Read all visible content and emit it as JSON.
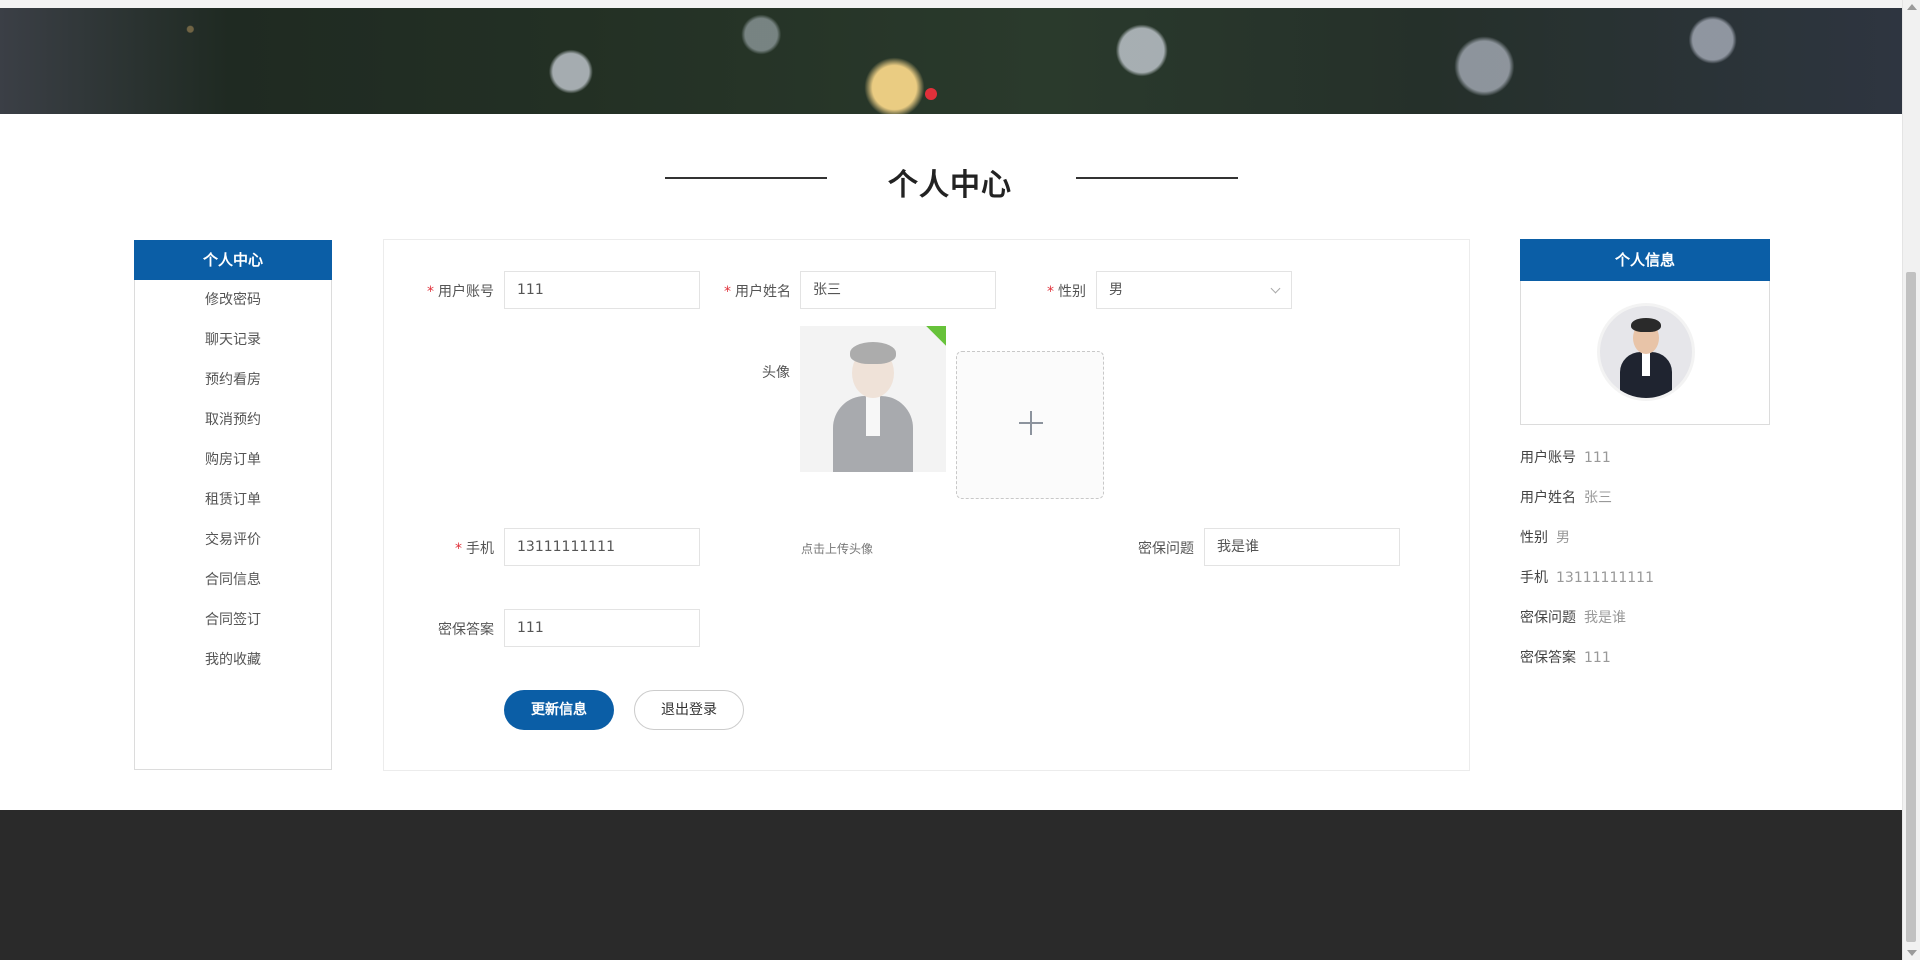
{
  "page": {
    "title": "个人中心"
  },
  "sidebar": {
    "header": "个人中心",
    "items": [
      {
        "label": "修改密码"
      },
      {
        "label": "聊天记录"
      },
      {
        "label": "预约看房"
      },
      {
        "label": "取消预约"
      },
      {
        "label": "购房订单"
      },
      {
        "label": "租赁订单"
      },
      {
        "label": "交易评价"
      },
      {
        "label": "合同信息"
      },
      {
        "label": "合同签订"
      },
      {
        "label": "我的收藏"
      }
    ]
  },
  "form": {
    "account": {
      "label": "用户账号",
      "value": "111",
      "required": "*"
    },
    "name": {
      "label": "用户姓名",
      "value": "张三",
      "required": "*"
    },
    "gender": {
      "label": "性别",
      "value": "男",
      "required": "*"
    },
    "avatar": {
      "label": "头像",
      "hint": "点击上传头像"
    },
    "phone": {
      "label": "手机",
      "value": "13111111111",
      "required": "*"
    },
    "question": {
      "label": "密保问题",
      "value": "我是谁"
    },
    "answer": {
      "label": "密保答案",
      "value": "111"
    },
    "update_button": "更新信息",
    "logout_button": "退出登录"
  },
  "info": {
    "header": "个人信息",
    "rows": [
      {
        "label": "用户账号",
        "value": "111"
      },
      {
        "label": "用户姓名",
        "value": "张三"
      },
      {
        "label": "性别",
        "value": "男"
      },
      {
        "label": "手机",
        "value": "13111111111"
      },
      {
        "label": "密保问题",
        "value": "我是谁"
      },
      {
        "label": "密保答案",
        "value": "111"
      }
    ]
  },
  "colors": {
    "primary": "#0b5ea6",
    "required": "#e0303a",
    "footer": "#2a2a2a"
  }
}
